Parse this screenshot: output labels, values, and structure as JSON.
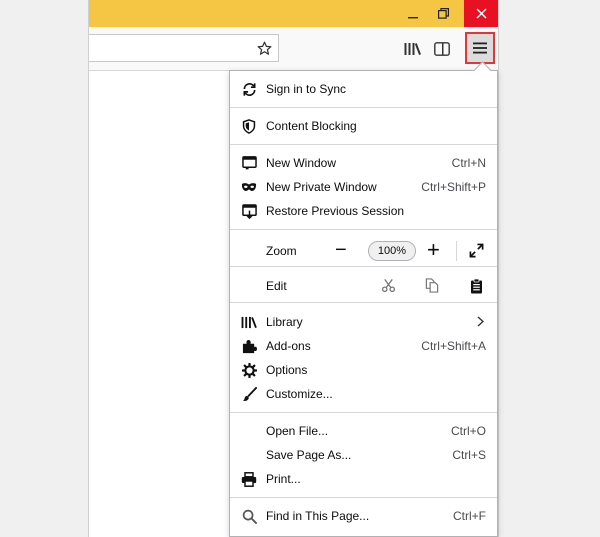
{
  "window": {
    "minimize_icon": "minimize-icon",
    "restore_icon": "restore-icon",
    "close_icon": "close-icon"
  },
  "toolbar": {
    "bookmark_icon": "star-icon",
    "library_icon": "library-icon",
    "sidebar_icon": "sidebar-icon",
    "menu_icon": "hamburger-icon"
  },
  "menu": {
    "sign_in": {
      "label": "Sign in to Sync",
      "icon": "sync-icon"
    },
    "content_blocking": {
      "label": "Content Blocking",
      "icon": "shield-icon"
    },
    "new_window": {
      "label": "New Window",
      "shortcut": "Ctrl+N",
      "icon": "new-window-icon"
    },
    "new_private_window": {
      "label": "New Private Window",
      "shortcut": "Ctrl+Shift+P",
      "icon": "mask-icon"
    },
    "restore_session": {
      "label": "Restore Previous Session",
      "icon": "restore-session-icon"
    },
    "zoom": {
      "label": "Zoom",
      "value": "100%",
      "minus": "−",
      "plus": "+"
    },
    "edit": {
      "label": "Edit"
    },
    "library": {
      "label": "Library",
      "icon": "library-icon"
    },
    "addons": {
      "label": "Add-ons",
      "shortcut": "Ctrl+Shift+A",
      "icon": "puzzle-icon"
    },
    "options": {
      "label": "Options",
      "icon": "gear-icon"
    },
    "customize": {
      "label": "Customize...",
      "icon": "brush-icon"
    },
    "open_file": {
      "label": "Open File...",
      "shortcut": "Ctrl+O"
    },
    "save_page": {
      "label": "Save Page As...",
      "shortcut": "Ctrl+S"
    },
    "print": {
      "label": "Print...",
      "icon": "printer-icon"
    },
    "find": {
      "label": "Find in This Page...",
      "shortcut": "Ctrl+F",
      "icon": "search-icon"
    }
  },
  "colors": {
    "titlebar": "#f5c544",
    "close": "#e81123",
    "highlight_border": "#e2373a"
  }
}
